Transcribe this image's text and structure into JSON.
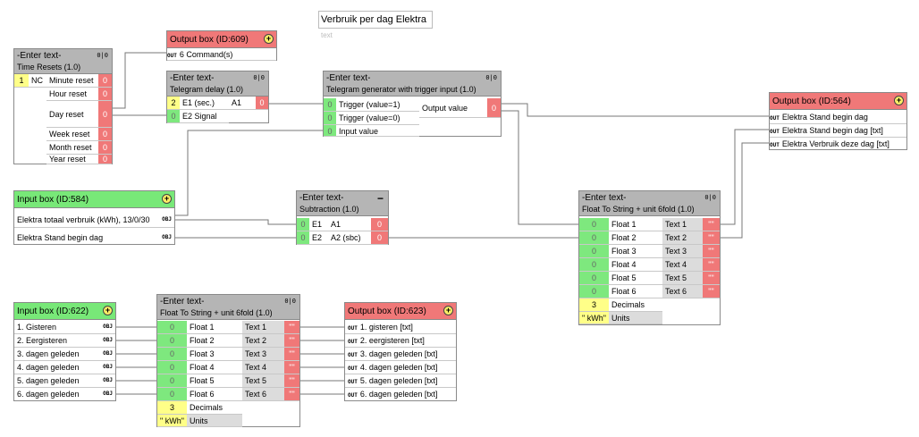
{
  "title_box": {
    "title": "Verbruik per dag Elektra",
    "sub": "text"
  },
  "pin_icon": "0|0",
  "time_resets": {
    "title": "-Enter text-",
    "subtitle": "Time Resets (1.0)",
    "in_val": "1",
    "in_lbl": "NC",
    "outputs": [
      "Minute reset",
      "Hour reset",
      "Day reset",
      "Week reset",
      "Month reset",
      "Year reset"
    ],
    "out_val": "0"
  },
  "output609": {
    "title": "Output box (ID:609)",
    "rows": [
      "6 Command(s)"
    ]
  },
  "telegram_delay": {
    "title": "-Enter text-",
    "subtitle": "Telegram delay (1.0)",
    "in1_val": "2",
    "in1_lbl": "E1 (sec.)",
    "in2_val": "0",
    "in2_lbl": "E2 Signal",
    "out_lbl": "A1",
    "out_val": "0"
  },
  "telegram_gen": {
    "title": "-Enter text-",
    "subtitle": "Telegram generator with trigger input (1.0)",
    "inputs": [
      "Trigger (value=1)",
      "Trigger (value=0)",
      "Input value"
    ],
    "in_val": "0",
    "out_lbl": "Output value",
    "out_val": "0"
  },
  "output564": {
    "title": "Output box (ID:564)",
    "rows": [
      "Elektra Stand begin dag",
      "Elektra Stand begin dag [txt]",
      "Elektra Verbruik deze dag [txt]"
    ]
  },
  "input584": {
    "title": "Input box (ID:584)",
    "rows": [
      "Elektra totaal verbruik (kWh), 13/0/30",
      "Elektra Stand begin dag"
    ]
  },
  "subtraction": {
    "title": "-Enter text-",
    "subtitle": "Subtraction (1.0)",
    "in_lbls": [
      "E1",
      "E2"
    ],
    "in_val": "0",
    "out_lbls": [
      "A1",
      "A2 (sbc)"
    ],
    "out_val": "0"
  },
  "fts1": {
    "title": "-Enter text-",
    "subtitle": "Float To String + unit 6fold (1.0)",
    "inputs": [
      "Float 1",
      "Float 2",
      "Float 3",
      "Float 4",
      "Float 5",
      "Float 6"
    ],
    "in_val": "0",
    "outputs": [
      "Text 1",
      "Text 2",
      "Text 3",
      "Text 4",
      "Text 5",
      "Text 6"
    ],
    "out_val": "\"\"",
    "dec_val": "3",
    "dec_lbl": "Decimals",
    "unit_val": "\" kWh\"",
    "unit_lbl": "Units"
  },
  "input622": {
    "title": "Input box (ID:622)",
    "rows": [
      "1. Gisteren",
      "2. Eergisteren",
      "3. dagen geleden",
      "4. dagen geleden",
      "5. dagen geleden",
      "6. dagen geleden"
    ]
  },
  "fts2": {
    "title": "-Enter text-",
    "subtitle": "Float To String + unit 6fold (1.0)",
    "inputs": [
      "Float 1",
      "Float 2",
      "Float 3",
      "Float 4",
      "Float 5",
      "Float 6"
    ],
    "in_val": "0",
    "outputs": [
      "Text 1",
      "Text 2",
      "Text 3",
      "Text 4",
      "Text 5",
      "Text 6"
    ],
    "out_val": "\"\"",
    "dec_val": "3",
    "dec_lbl": "Decimals",
    "unit_val": "\" kWh\"",
    "unit_lbl": "Units"
  },
  "output623": {
    "title": "Output box (ID:623)",
    "rows": [
      "1. gisteren [txt]",
      "2. eergisteren [txt]",
      "3. dagen geleden [txt]",
      "4. dagen geleden [txt]",
      "5. dagen geleden [txt]",
      "6. dagen geleden [txt]"
    ]
  },
  "tags": {
    "obj": "OBJ",
    "out": "OUT"
  }
}
